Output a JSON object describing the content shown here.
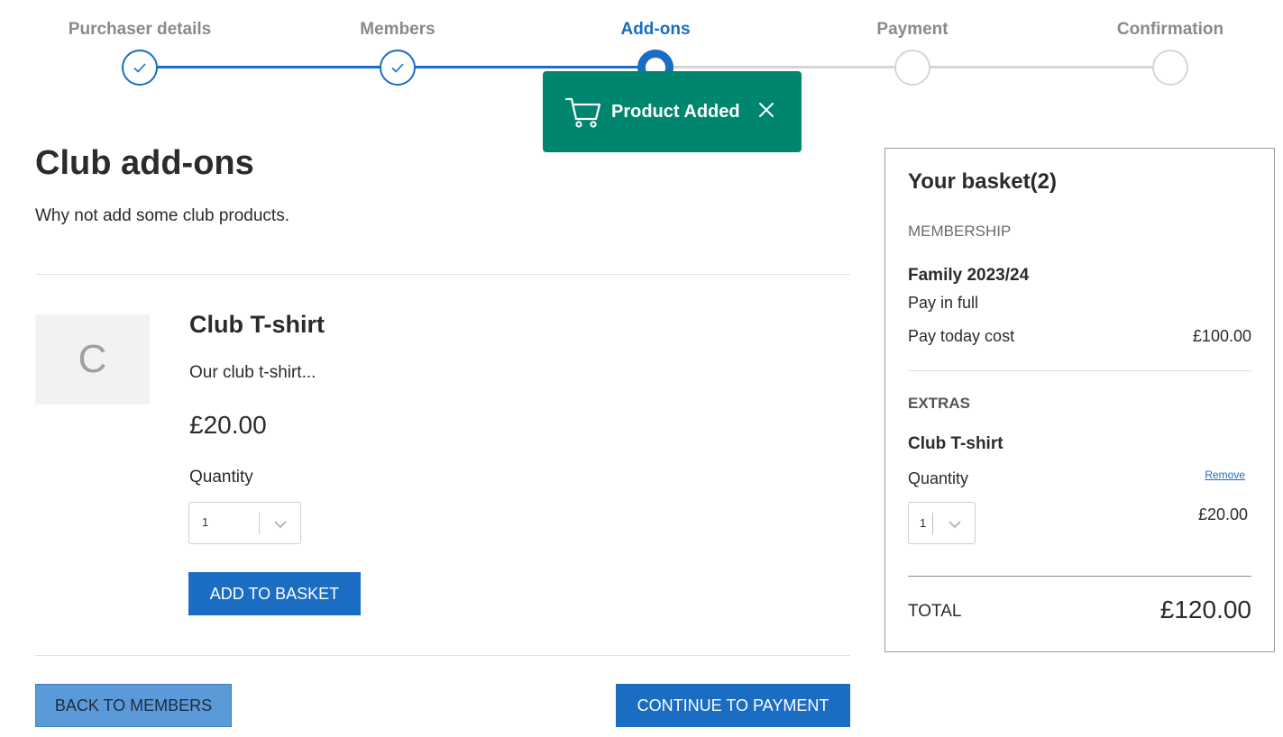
{
  "stepper": {
    "steps": [
      {
        "label": "Purchaser details",
        "state": "done"
      },
      {
        "label": "Members",
        "state": "done"
      },
      {
        "label": "Add-ons",
        "state": "current"
      },
      {
        "label": "Payment",
        "state": "todo"
      },
      {
        "label": "Confirmation",
        "state": "todo"
      }
    ],
    "icons": {
      "done": "check-icon"
    }
  },
  "toast": {
    "text": "Product Added",
    "icon": "cart-icon",
    "close_icon": "close-icon",
    "color": "#00856f"
  },
  "main": {
    "title": "Club add-ons",
    "subtitle": "Why not add some club products.",
    "product": {
      "thumb_letter": "C",
      "name": "Club T-shirt",
      "description": "Our club t-shirt...",
      "price": "£20.00",
      "quantity_label": "Quantity",
      "quantity_value": "1",
      "add_button": "ADD TO BASKET"
    },
    "back_button": "BACK TO MEMBERS",
    "continue_button": "CONTINUE TO PAYMENT"
  },
  "basket": {
    "title": "Your basket(2)",
    "membership_heading": "MEMBERSHIP",
    "membership": {
      "name": "Family 2023/24",
      "plan": "Pay in full",
      "cost_label": "Pay today cost",
      "cost_value": "£100.00"
    },
    "extras_heading": "EXTRAS",
    "extra": {
      "name": "Club T-shirt",
      "quantity_label": "Quantity",
      "remove_label": "Remove",
      "quantity_value": "1",
      "price": "£20.00"
    },
    "total_label": "TOTAL",
    "total_value": "£120.00"
  },
  "colors": {
    "primary": "#1a6dc2",
    "secondary": "#5b9ad8",
    "inactive_step": "#d6d6d6"
  }
}
